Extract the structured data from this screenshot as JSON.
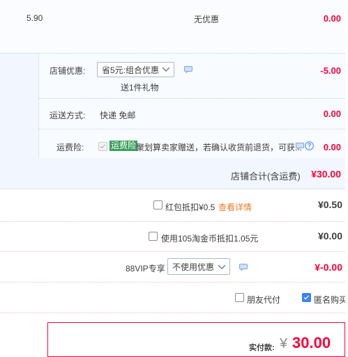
{
  "item": {
    "price": "5.90",
    "discount_label": "无优惠",
    "subtotal": "0.00"
  },
  "shop_discount": {
    "label": "店铺优惠:",
    "selected": "省5元:组合优惠",
    "gift": "送1件礼物",
    "amount": "-5.00"
  },
  "shipping": {
    "label": "运送方式:",
    "value": "快递 免邮",
    "amount": "0.00"
  },
  "insurance": {
    "label": "运费险:",
    "badge": "运费险",
    "text": "聚划算卖家赠送，若确认收货前退货，可获...",
    "amount": "0.00"
  },
  "shop_total": {
    "label": "店铺合计(含运费)",
    "amount": "¥30.00"
  },
  "red_packet": {
    "label": "红包抵扣¥0.5",
    "link": "查看详情",
    "amount": "¥0.50"
  },
  "coins": {
    "label": "使用105淘金币抵扣1.05元",
    "amount": "¥0.00"
  },
  "vip": {
    "label": "88VIP专享",
    "selected": "不使用优惠",
    "amount": "¥-0.00"
  },
  "options": {
    "friend_pay": "朋友代付",
    "anonymous": "匿名购买"
  },
  "payment": {
    "label": "实付款:",
    "currency": "¥",
    "amount": "30.00"
  },
  "colors": {
    "accent_red": "#ff0036",
    "link_orange": "#f07a2a",
    "checkbox_blue": "#3b82f6",
    "badge_green": "#3aa05a"
  }
}
